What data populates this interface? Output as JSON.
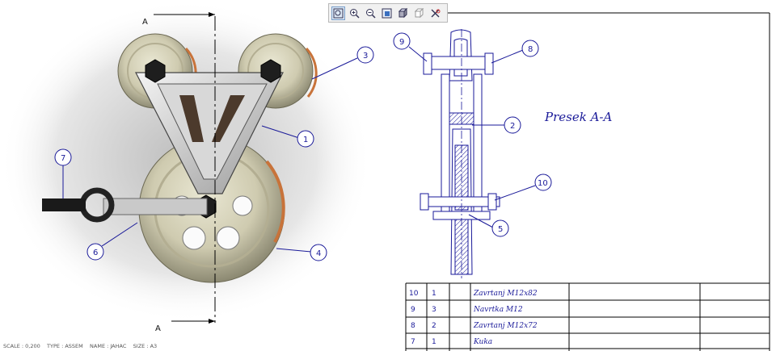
{
  "toolbar": {
    "items": [
      {
        "icon": "zoom-fit-icon"
      },
      {
        "icon": "zoom-in-icon"
      },
      {
        "icon": "zoom-out-icon"
      },
      {
        "icon": "zoom-window-icon"
      },
      {
        "icon": "shaded-view-icon"
      },
      {
        "icon": "view-orientation-icon"
      },
      {
        "icon": "close-view-icon"
      }
    ]
  },
  "drawing": {
    "section_title": "Presek  A-A",
    "section_markers": {
      "top": "A",
      "bottom": "A"
    },
    "balloons": [
      {
        "number": "9"
      },
      {
        "number": "8"
      },
      {
        "number": "3"
      },
      {
        "number": "2"
      },
      {
        "number": "1"
      },
      {
        "number": "7"
      },
      {
        "number": "10"
      },
      {
        "number": "5"
      },
      {
        "number": "6"
      },
      {
        "number": "4"
      }
    ]
  },
  "bom": {
    "rows": [
      {
        "pos": "10",
        "qty": "1",
        "name": "Zavrtanj M12x82"
      },
      {
        "pos": "9",
        "qty": "3",
        "name": "Navrtka M12"
      },
      {
        "pos": "8",
        "qty": "2",
        "name": "Zavrtanj M12x72"
      },
      {
        "pos": "7",
        "qty": "1",
        "name": "Kuka"
      }
    ]
  },
  "status": {
    "scale": "SCALE : 0,200",
    "type": "TYPE : ASSEM",
    "name": "NAME : JAHAC",
    "size": "SIZE : A3"
  },
  "colors": {
    "annotation": "#1a1a99",
    "line": "#000000",
    "toolbar": "#f1f1f1"
  }
}
